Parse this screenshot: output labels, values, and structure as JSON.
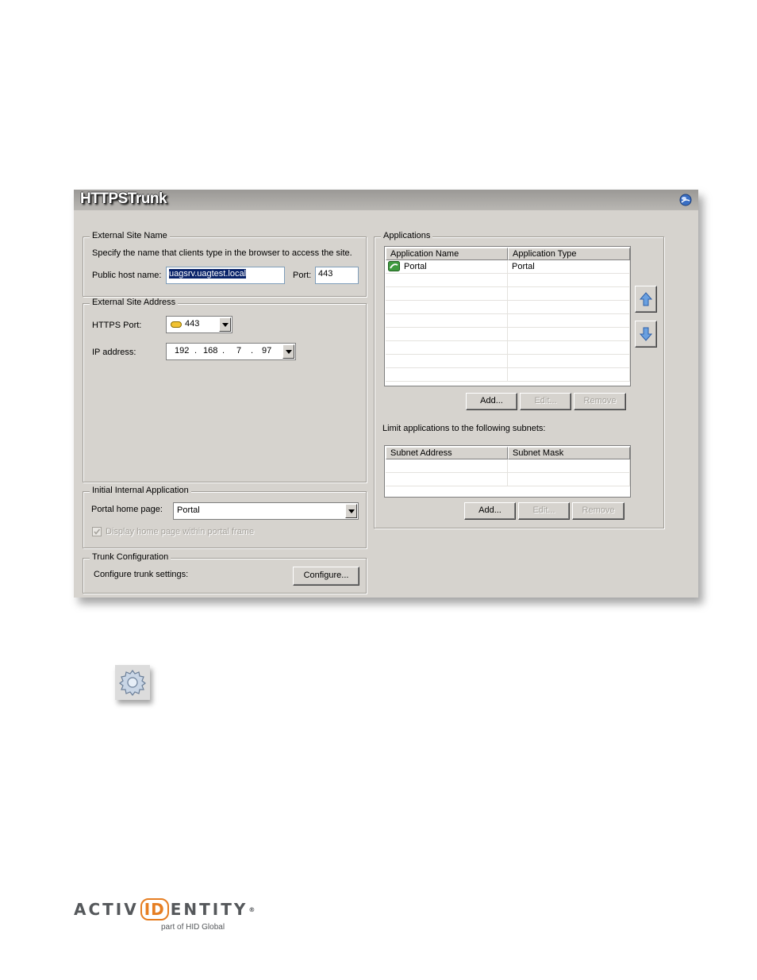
{
  "window": {
    "title": "HTTPSTrunk"
  },
  "external_site_name": {
    "legend": "External Site Name",
    "description": "Specify the name that clients type in the browser to access the site.",
    "host_label": "Public host name:",
    "host_value": "uagsrv.uagtest.local",
    "port_label": "Port:",
    "port_value": "443"
  },
  "external_site_address": {
    "legend": "External Site Address",
    "https_port_label": "HTTPS Port:",
    "https_port_value": "443",
    "ip_label": "IP address:",
    "ip_octets": [
      "192",
      "168",
      "7",
      "97"
    ]
  },
  "initial_internal_application": {
    "legend": "Initial Internal Application",
    "portal_label": "Portal home page:",
    "portal_value": "Portal",
    "display_checkbox_label": "Display home page within portal frame",
    "display_checked": true
  },
  "trunk_configuration": {
    "legend": "Trunk Configuration",
    "label": "Configure trunk settings:",
    "configure_button": "Configure..."
  },
  "applications": {
    "legend": "Applications",
    "columns": [
      "Application Name",
      "Application Type"
    ],
    "rows": [
      {
        "name": "Portal",
        "type": "Portal",
        "icon": "portal-app-icon"
      }
    ],
    "add_button": "Add...",
    "edit_button": "Edit...",
    "remove_button": "Remove",
    "subnets_label": "Limit applications to the following subnets:",
    "subnet_columns": [
      "Subnet Address",
      "Subnet Mask"
    ],
    "subnet_add_button": "Add...",
    "subnet_edit_button": "Edit...",
    "subnet_remove_button": "Remove"
  },
  "logo": {
    "prefix": "ACTIV",
    "id": "ID",
    "suffix": "ENTITY",
    "registered": "®",
    "tagline": "part of HID Global",
    "colors": {
      "orange": "#e67e22",
      "gray": "#55585b"
    }
  }
}
